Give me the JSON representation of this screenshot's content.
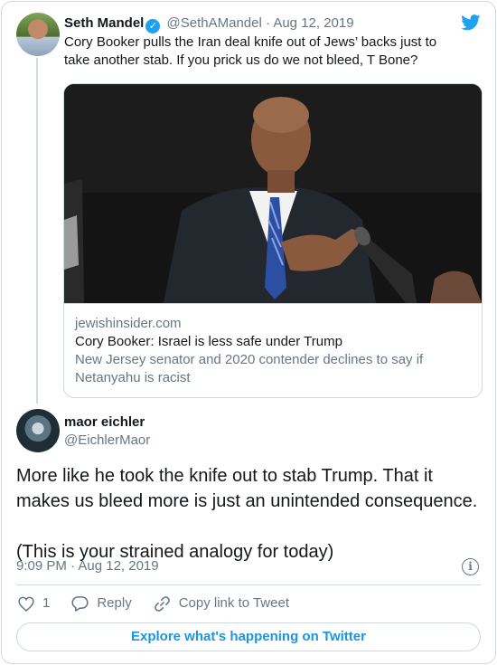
{
  "parent_tweet": {
    "display_name": "Seth Mandel",
    "handle": "@SethAMandel",
    "date": "· Aug 12, 2019",
    "text": "Cory Booker pulls the Iran deal knife out of Jews’ backs just to take another stab. If you prick us do we not bleed, T Bone?",
    "verified_icon": "verified-badge-icon",
    "link_card": {
      "domain": "jewishinsider.com",
      "title": "Cory Booker: Israel is less safe under Trump",
      "description": "New Jersey senator and 2020 contender declines to say if Netanyahu is racist"
    }
  },
  "reply_tweet": {
    "display_name": "maor eichler",
    "handle": "@EichlerMaor",
    "text": "More like he took the knife out to stab Trump. That it makes us bleed more is just an unintended consequence.\n\n(This is your strained analogy for today)",
    "timestamp": "9:09 PM · Aug 12, 2019",
    "like_count": "1",
    "reply_label": "Reply",
    "copy_link_label": "Copy link to Tweet",
    "explore_label": "Explore what's happening on Twitter"
  },
  "colors": {
    "brand_blue": "#1da1f2",
    "link_blue": "#1b95e0",
    "muted": "#657786",
    "border": "#cfd9de"
  }
}
